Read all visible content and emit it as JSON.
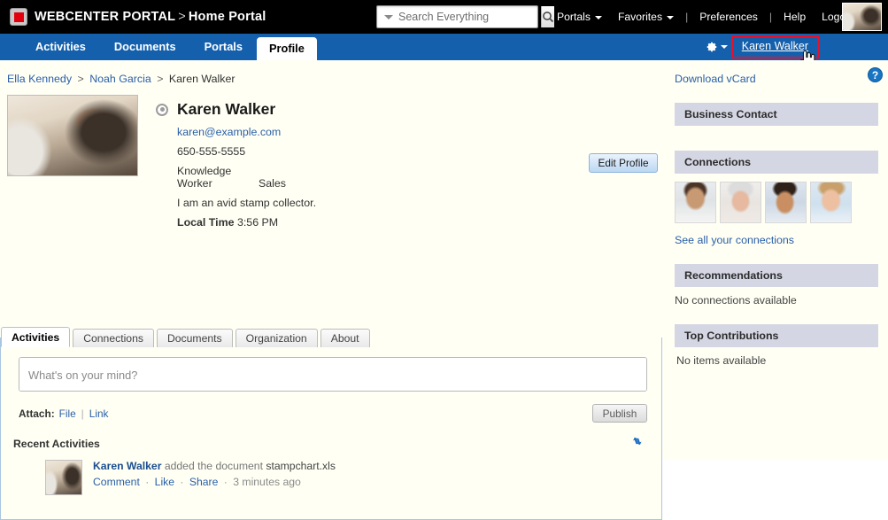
{
  "header": {
    "brand_name": "WEBCENTER PORTAL",
    "brand_separator": ">",
    "page_name": "Home Portal",
    "logo_icon": "webcenter-logo-icon",
    "search": {
      "placeholder": "Search Everything",
      "value": "",
      "caret_icon": "chevron-down-icon",
      "button_icon": "search-icon"
    },
    "nav": [
      {
        "label": "Portals",
        "dropdown": true
      },
      {
        "label": "Favorites",
        "dropdown": true
      },
      {
        "label": "Preferences",
        "dropdown": false
      },
      {
        "label": "Help",
        "dropdown": false
      },
      {
        "label": "Logout",
        "dropdown": false
      }
    ],
    "avatar_name": "user-avatar-photo"
  },
  "navbar": {
    "tabs": [
      {
        "label": "Activities",
        "active": false
      },
      {
        "label": "Documents",
        "active": false
      },
      {
        "label": "Portals",
        "active": false
      },
      {
        "label": "Profile",
        "active": true
      }
    ],
    "gear_icon": "gear-icon",
    "gear_caret_icon": "chevron-down-icon",
    "user_link": "Karen Walker",
    "highlight_color": "#e8112d",
    "cursor_icon": "hand-pointer-cursor"
  },
  "page": {
    "help_icon_label": "?",
    "accent_blue": "#1560ac",
    "background": "#fffff4"
  },
  "breadcrumb": {
    "items": [
      "Ella Kennedy",
      "Noah Garcia",
      "Karen Walker"
    ],
    "separator": ">"
  },
  "profile": {
    "edit_button": "Edit Profile",
    "photo_name": "karen-walker-profile-photo",
    "status_icon": "presence-status-icon",
    "name": "Karen Walker",
    "email": "karen@example.com",
    "phone": "650-555-5555",
    "job_title": "Knowledge Worker",
    "department": "Sales",
    "about": "I am an avid stamp collector.",
    "local_time_label": "Local Time",
    "local_time_value": "3:56 PM"
  },
  "content_tabs": [
    {
      "label": "Activities",
      "active": true
    },
    {
      "label": "Connections",
      "active": false
    },
    {
      "label": "Documents",
      "active": false
    },
    {
      "label": "Organization",
      "active": false
    },
    {
      "label": "About",
      "active": false
    }
  ],
  "composer": {
    "placeholder": "What's on your mind?",
    "value": "",
    "attach_label": "Attach:",
    "attach_file": "File",
    "attach_link": "Link",
    "attach_divider": "|",
    "publish_label": "Publish"
  },
  "recent_activities": {
    "heading": "Recent Activities",
    "refresh_icon": "refresh-icon",
    "items": [
      {
        "thumb_name": "activity-author-thumbnail",
        "author": "Karen Walker",
        "action": "added the document",
        "target": "stampchart.xls",
        "comment_label": "Comment",
        "like_label": "Like",
        "share_label": "Share",
        "separator": "·",
        "timestamp": "3 minutes ago"
      }
    ]
  },
  "sidebar": {
    "download_vcard": "Download vCard",
    "business_contact": {
      "title": "Business Contact",
      "body": ""
    },
    "connections": {
      "title": "Connections",
      "thumbs": [
        "connection-thumb-1",
        "connection-thumb-2",
        "connection-thumb-3",
        "connection-thumb-4"
      ],
      "see_all": "See all your connections"
    },
    "recommendations": {
      "title": "Recommendations",
      "body": "No connections available"
    },
    "top_contributions": {
      "title": "Top Contributions",
      "body": "No items available"
    }
  }
}
